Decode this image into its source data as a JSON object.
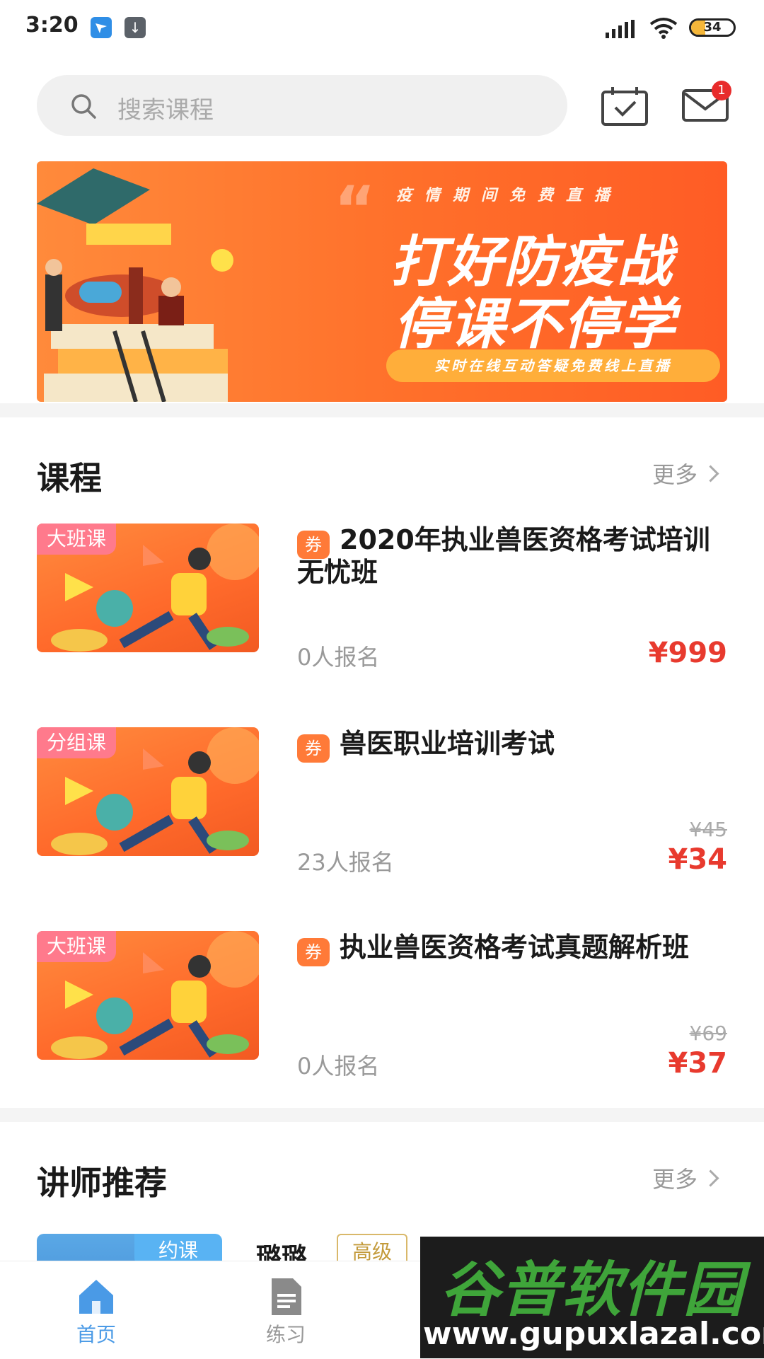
{
  "status_bar": {
    "time": "3:20",
    "battery": "34",
    "battery_level": 0.34,
    "icons": [
      "app-notification-icon",
      "download-icon",
      "signal-icon",
      "wifi-icon",
      "battery-icon"
    ]
  },
  "header": {
    "search_placeholder": "搜索课程",
    "mail_badge": "1",
    "icons": [
      "search-icon",
      "calendar-check-icon",
      "mail-icon"
    ]
  },
  "banner": {
    "top_line": "疫情期间免费直播",
    "headline_1": "打好防疫战",
    "headline_2": "停课不停学",
    "pill_text": "实时在线互动答疑免费线上直播"
  },
  "courses_section": {
    "title": "课程",
    "more": "更多",
    "items": [
      {
        "tag": "大班课",
        "coupon": "券",
        "title": "2020年执业兽医资格考试培训无忧班",
        "enrolled": "0人报名",
        "price": "¥999",
        "old_price": ""
      },
      {
        "tag": "分组课",
        "coupon": "券",
        "title": "兽医职业培训考试",
        "enrolled": "23人报名",
        "price": "¥34",
        "old_price": "¥45"
      },
      {
        "tag": "大班课",
        "coupon": "券",
        "title": "执业兽医资格考试真题解析班",
        "enrolled": "0人报名",
        "price": "¥37",
        "old_price": "¥69"
      }
    ]
  },
  "teachers_section": {
    "title": "讲师推荐",
    "more": "更多",
    "teacher": {
      "tag": "约课",
      "name": "璐璐",
      "level": "高级"
    }
  },
  "bottom_nav": {
    "items": [
      {
        "label": "首页",
        "icon": "home-icon",
        "active": true
      },
      {
        "label": "练习",
        "icon": "document-icon",
        "active": false
      }
    ]
  },
  "watermark": {
    "title": "谷普软件园",
    "url": "www.gupuxlazal.com"
  },
  "colors": {
    "accent": "#4a9ae6",
    "price": "#e83a2e",
    "banner": "#ff6f2a"
  }
}
